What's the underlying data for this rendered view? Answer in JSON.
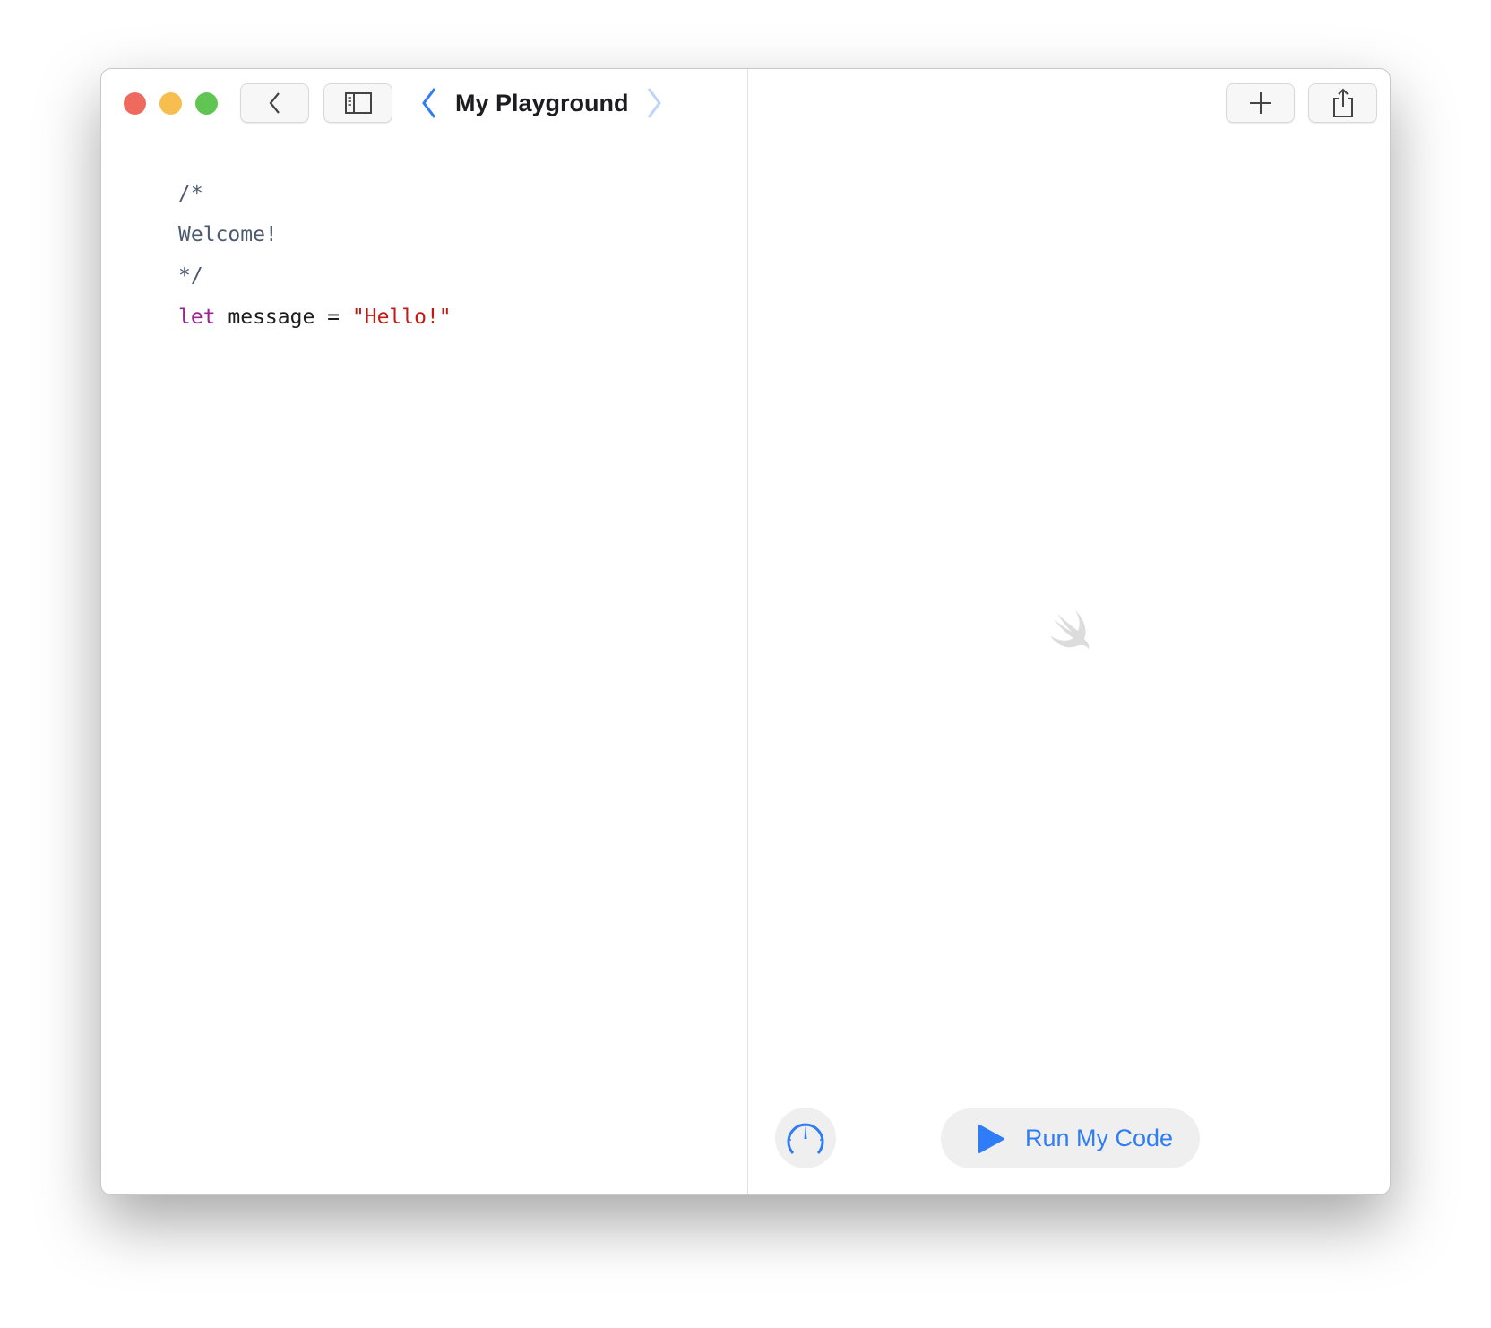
{
  "window": {
    "title": "My Playground",
    "traffic_lights": {
      "close": "#ee6a5f",
      "minimize": "#f5be4f",
      "zoom": "#61c554"
    }
  },
  "toolbar": {
    "back_icon": "chevron-left-icon",
    "sidebar_icon": "sidebar-icon",
    "prev_page_icon": "chevron-left-icon",
    "next_page_icon": "chevron-right-icon",
    "add_icon": "plus-icon",
    "share_icon": "share-icon"
  },
  "editor": {
    "lines": {
      "l1": "/*",
      "l2": "Welcome!",
      "l3": "*/",
      "l4_keyword": "let",
      "l4_rest": " message = ",
      "l4_string": "\"Hello!\""
    }
  },
  "live_view": {
    "placeholder_icon": "swift-logo-icon",
    "speed_icon": "speedometer-icon",
    "run_label": "Run My Code",
    "accent": "#2f7df6"
  }
}
